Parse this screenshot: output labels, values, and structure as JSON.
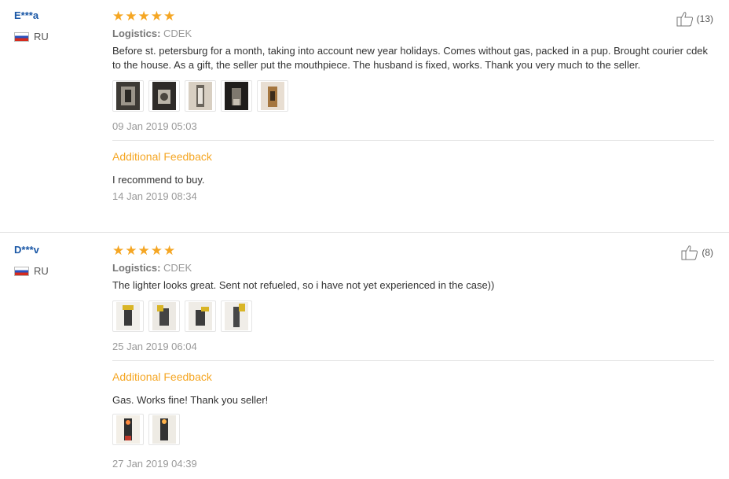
{
  "feedbacks": [
    {
      "user": "E***a",
      "country": "RU",
      "stars": "★★★★★",
      "logistics_label": "Logistics:",
      "logistics_value": "CDEK",
      "text": "Before st. petersburg for a month, taking into account new year holidays. Comes without gas, packed in a pup. Brought courier cdek to the house. As a gift, the seller put the mouthpiece. The husband is fixed, works. Thank you very much to the seller.",
      "date": "09 Jan 2019 05:03",
      "helpful_count": "(13)",
      "additional": {
        "title": "Additional Feedback",
        "text": "I recommend to buy.",
        "date": "14 Jan 2019 08:34"
      }
    },
    {
      "user": "D***v",
      "country": "RU",
      "stars": "★★★★★",
      "logistics_label": "Logistics:",
      "logistics_value": "CDEK",
      "text": "The lighter looks great. Sent not refueled, so i have not yet experienced in the case))",
      "date": "25 Jan 2019 06:04",
      "helpful_count": "(8)",
      "additional": {
        "title": "Additional Feedback",
        "text": "Gas. Works fine! Thank you seller!",
        "date": "27 Jan 2019 04:39"
      }
    }
  ],
  "icons": {
    "thumb_up": "thumbs-up-icon",
    "flag": "russia-flag-icon"
  },
  "colors": {
    "accent": "#f5a623",
    "user": "#1a57a6",
    "muted": "#999999"
  }
}
